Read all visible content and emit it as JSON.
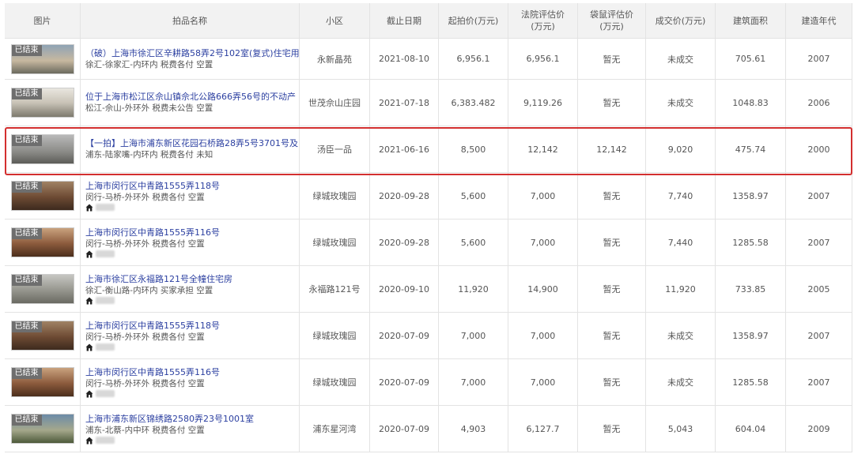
{
  "headers": {
    "image": "图片",
    "name": "拍品名称",
    "community": "小区",
    "deadline": "截止日期",
    "start_price": "起拍价(万元)",
    "court_price_l1": "法院评估价",
    "court_price_l2": "(万元)",
    "bag_price_l1": "袋鼠评估价",
    "bag_price_l2": "(万元)",
    "deal_price": "成交价(万元)",
    "area": "建筑面积",
    "year": "建造年代"
  },
  "status_tag": "已结束",
  "rows": [
    {
      "title": "（破）上海市徐汇区辛耕路58弄2号102室(复式)住宅用",
      "sub": "徐汇-徐家汇-内环内 税费各付 空置",
      "community": "永新晶苑",
      "deadline": "2021-08-10",
      "start": "6,956.1",
      "court": "6,956.1",
      "bag": "暂无",
      "deal": "未成交",
      "area": "705.61",
      "year": "2007"
    },
    {
      "title": "位于上海市松江区佘山镇佘北公路666弄56号的不动产",
      "sub": "松江-佘山-外环外 税费未公告 空置",
      "community": "世茂佘山庄园",
      "deadline": "2021-07-18",
      "start": "6,383.482",
      "court": "9,119.26",
      "bag": "暂无",
      "deal": "未成交",
      "area": "1048.83",
      "year": "2006"
    },
    {
      "title": "【一拍】上海市浦东新区花园石桥路28弄5号3701号及",
      "sub": "浦东-陆家嘴-内环内 税费各付 未知",
      "community": "汤臣一品",
      "deadline": "2021-06-16",
      "start": "8,500",
      "court": "12,142",
      "bag": "12,142",
      "deal": "9,020",
      "area": "475.74",
      "year": "2000"
    },
    {
      "title": "上海市闵行区中青路1555弄118号",
      "sub": "闵行-马桥-外环外 税费各付 空置",
      "community": "绿城玫瑰园",
      "deadline": "2020-09-28",
      "start": "5,600",
      "court": "7,000",
      "bag": "暂无",
      "deal": "7,740",
      "area": "1358.97",
      "year": "2007"
    },
    {
      "title": "上海市闵行区中青路1555弄116号",
      "sub": "闵行-马桥-外环外 税费各付 空置",
      "community": "绿城玫瑰园",
      "deadline": "2020-09-28",
      "start": "5,600",
      "court": "7,000",
      "bag": "暂无",
      "deal": "7,440",
      "area": "1285.58",
      "year": "2007"
    },
    {
      "title": "上海市徐汇区永福路121号全幢住宅房",
      "sub": "徐汇-衡山路-内环内 买家承担 空置",
      "community": "永福路121号",
      "deadline": "2020-09-10",
      "start": "11,920",
      "court": "14,900",
      "bag": "暂无",
      "deal": "11,920",
      "area": "733.85",
      "year": "2005"
    },
    {
      "title": "上海市闵行区中青路1555弄118号",
      "sub": "闵行-马桥-外环外 税费各付 空置",
      "community": "绿城玫瑰园",
      "deadline": "2020-07-09",
      "start": "7,000",
      "court": "7,000",
      "bag": "暂无",
      "deal": "未成交",
      "area": "1358.97",
      "year": "2007"
    },
    {
      "title": "上海市闵行区中青路1555弄116号",
      "sub": "闵行-马桥-外环外 税费各付 空置",
      "community": "绿城玫瑰园",
      "deadline": "2020-07-09",
      "start": "7,000",
      "court": "7,000",
      "bag": "暂无",
      "deal": "未成交",
      "area": "1285.58",
      "year": "2007"
    },
    {
      "title": "上海市浦东新区锦绣路2580弄23号1001室",
      "sub": "浦东-北蔡-内中环 税费各付 空置",
      "community": "浦东星河湾",
      "deadline": "2020-07-09",
      "start": "4,903",
      "court": "6,127.7",
      "bag": "暂无",
      "deal": "5,043",
      "area": "604.04",
      "year": "2009"
    }
  ]
}
